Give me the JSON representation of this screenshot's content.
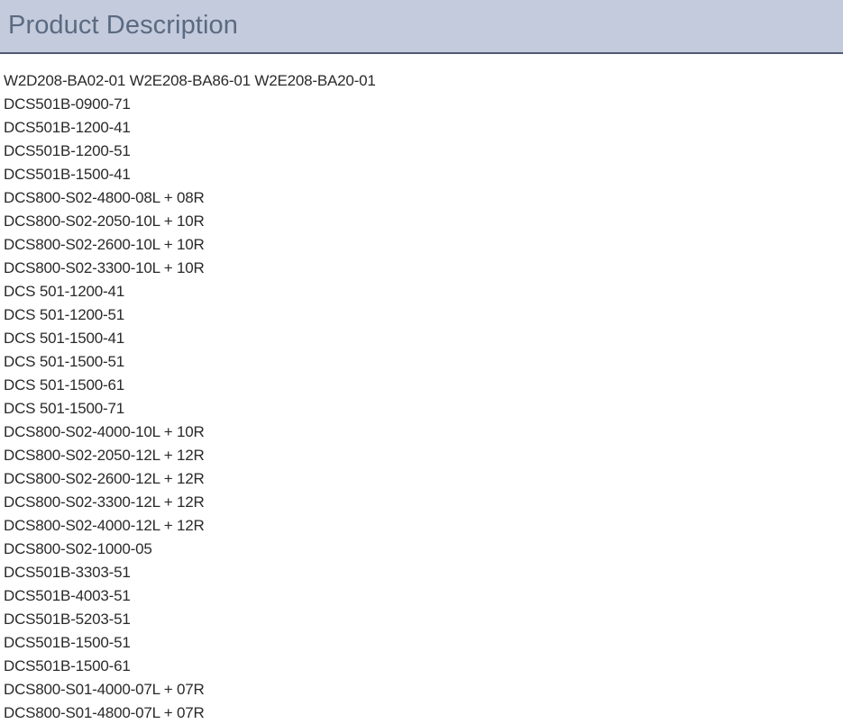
{
  "header": {
    "title": "Product Description"
  },
  "products": [
    "W2D208-BA02-01 W2E208-BA86-01 W2E208-BA20-01",
    "DCS501B-0900-71",
    "DCS501B-1200-41",
    "DCS501B-1200-51",
    "DCS501B-1500-41",
    "DCS800-S02-4800-08L + 08R",
    "DCS800-S02-2050-10L + 10R",
    "DCS800-S02-2600-10L + 10R",
    "DCS800-S02-3300-10L + 10R",
    "DCS 501-1200-41",
    "DCS 501-1200-51",
    "DCS 501-1500-41",
    "DCS 501-1500-51",
    "DCS 501-1500-61",
    "DCS 501-1500-71",
    "DCS800-S02-4000-10L + 10R",
    "DCS800-S02-2050-12L + 12R",
    "DCS800-S02-2600-12L + 12R",
    "DCS800-S02-3300-12L + 12R",
    "DCS800-S02-4000-12L + 12R",
    "DCS800-S02-1000-05",
    "DCS501B-3303-51",
    "DCS501B-4003-51",
    "DCS501B-5203-51",
    "DCS501B-1500-51",
    "DCS501B-1500-61",
    "DCS800-S01-4000-07L + 07R",
    "DCS800-S01-4800-07L + 07R"
  ],
  "colors": {
    "header_background": "#c4cbdc",
    "header_border": "#4f5970",
    "header_text": "#5a6a82",
    "body_text": "#2a2a2a"
  }
}
